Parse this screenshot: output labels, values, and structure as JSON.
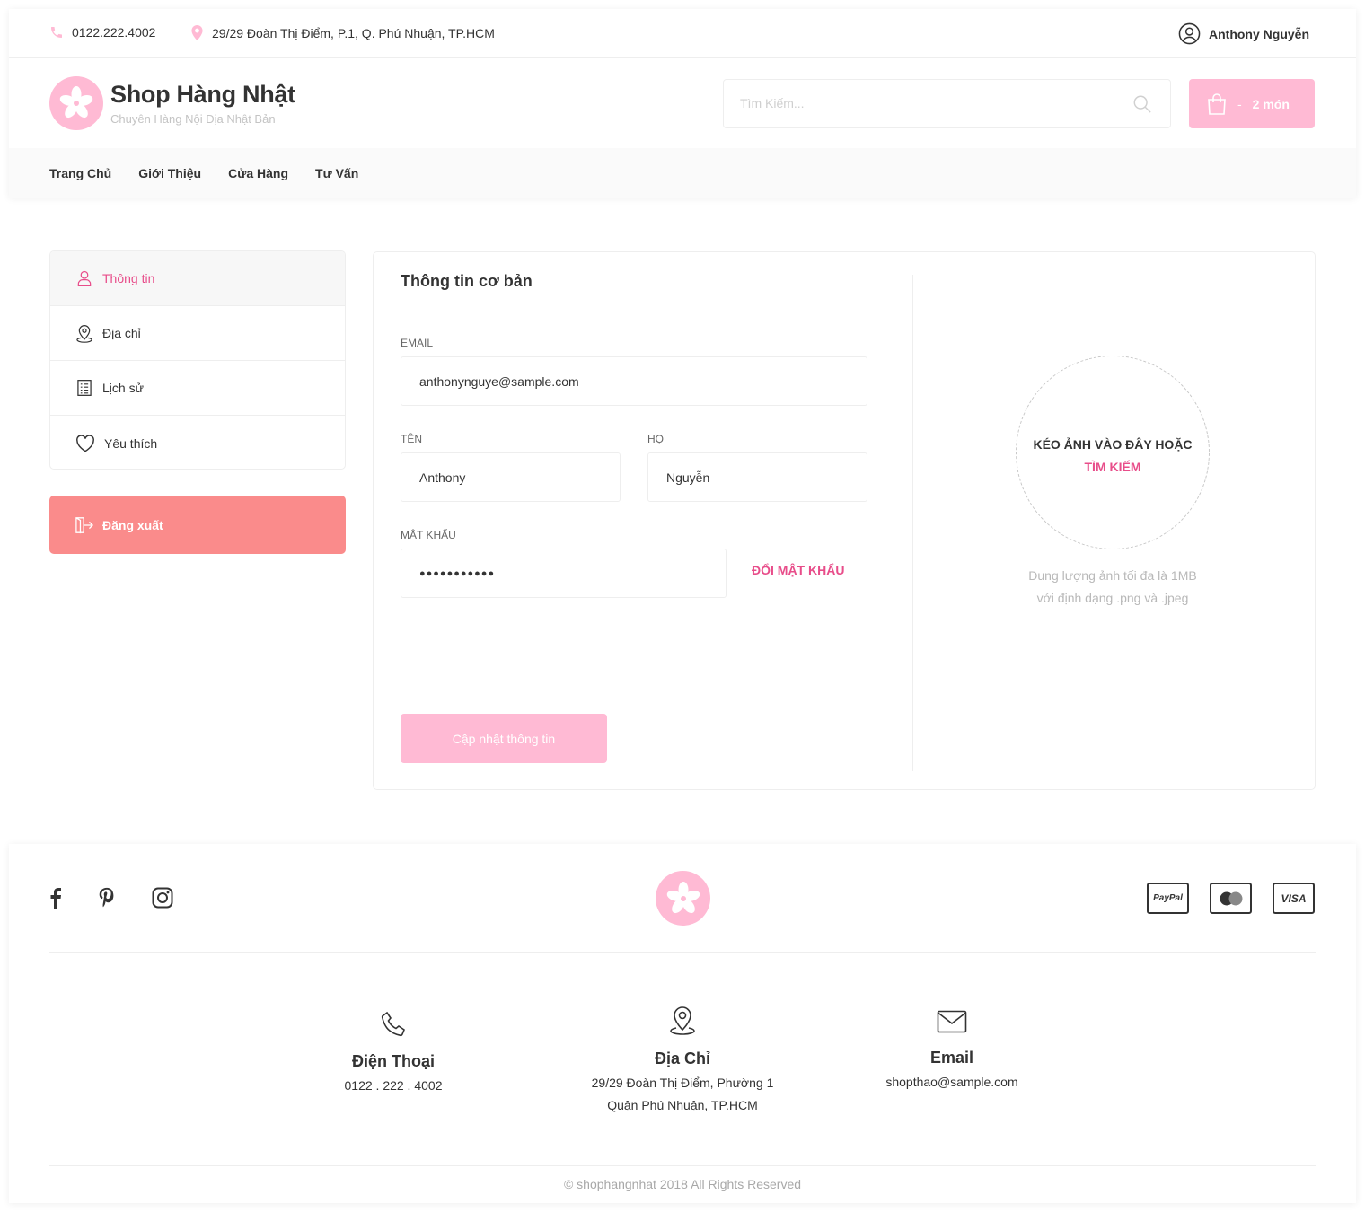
{
  "topbar": {
    "phone": "0122.222.4002",
    "address": "29/29 Đoàn Thị Điểm, P.1, Q. Phú Nhuận, TP.HCM",
    "user": "Anthony Nguyễn"
  },
  "header": {
    "brand": "Shop Hàng Nhật",
    "tagline": "Chuyên Hàng Nội Địa Nhật Bản",
    "search_placeholder": "Tìm Kiếm...",
    "cart_dash": "-",
    "cart_count": "2 món"
  },
  "nav": [
    "Trang Chủ",
    "Giới Thiệu",
    "Cửa Hàng",
    "Tư Vấn"
  ],
  "sidebar": {
    "items": [
      {
        "label": "Thông tin",
        "icon": "user-icon",
        "active": true
      },
      {
        "label": "Địa chỉ",
        "icon": "location-icon",
        "active": false
      },
      {
        "label": "Lịch sử",
        "icon": "history-icon",
        "active": false
      },
      {
        "label": "Yêu thích",
        "icon": "heart-icon",
        "active": false
      }
    ],
    "logout": "Đăng xuất"
  },
  "form": {
    "title": "Thông tin cơ bản",
    "email_label": "EMAIL",
    "email_value": "anthonynguye@sample.com",
    "first_name_label": "TÊN",
    "first_name_value": "Anthony",
    "last_name_label": "HỌ",
    "last_name_value": "Nguyễn",
    "password_label": "MẬT KHẨU",
    "password_value": "●●●●●●●●●●●",
    "change_password": "ĐỔI MẬT KHẨU",
    "update_button": "Cập nhật thông tin"
  },
  "avatar_upload": {
    "line1": "KÉO ẢNH VÀO ĐÂY HOẶC",
    "line2": "TÌM KIẾM",
    "note_line1": "Dung lượng ảnh tối đa là 1MB",
    "note_line2": "với định dạng .png và .jpeg"
  },
  "footer": {
    "social": [
      "facebook-icon",
      "pinterest-icon",
      "instagram-icon"
    ],
    "payments": [
      "PayPal",
      "",
      "VISA"
    ],
    "contacts": [
      {
        "title": "Điện Thoại",
        "line1": "0122 . 222 . 4002",
        "line2": ""
      },
      {
        "title": "Địa Chỉ",
        "line1": "29/29 Đoàn Thị Điểm, Phường 1",
        "line2": "Quận Phú Nhuận, TP.HCM"
      },
      {
        "title": "Email",
        "line1": "shopthao@sample.com",
        "line2": ""
      }
    ],
    "copyright": "© shophangnhat 2018 All Rights Reserved"
  },
  "colors": {
    "brand_pink": "#ffbad4",
    "accent_pink": "#e84d8a",
    "logout_red": "#fa8b8b"
  }
}
